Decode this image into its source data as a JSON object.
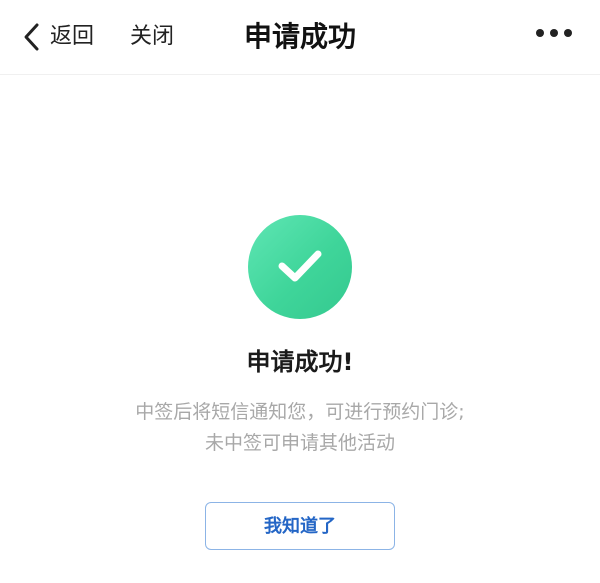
{
  "nav": {
    "back_label": "返回",
    "close_label": "关闭",
    "title": "申请成功",
    "back_icon": "chevron-left-icon",
    "more_icon": "more-dots-icon"
  },
  "result": {
    "status_icon": "checkmark-icon",
    "icon_color": "#3fd59a",
    "title": "申请成功!",
    "description_lines": [
      "中签后将短信通知您，可进行预约门诊;",
      "未中签可申请其他活动"
    ]
  },
  "action": {
    "button_label": "我知道了",
    "button_color": "#2466c6"
  }
}
